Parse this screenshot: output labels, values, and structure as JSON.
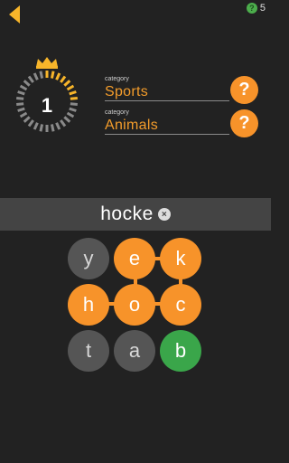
{
  "header": {
    "hint_count": "5",
    "hint_icon": "?"
  },
  "level": {
    "number": "1",
    "dial_filled_fraction": 0.25
  },
  "categories": [
    {
      "label": "category",
      "value": "Sports",
      "help_icon": "?"
    },
    {
      "label": "category",
      "value": "Animals",
      "help_icon": "?"
    }
  ],
  "word": {
    "current": "hocke",
    "clear_icon": "×"
  },
  "grid": {
    "rows": [
      [
        {
          "letter": "y",
          "state": "grey"
        },
        {
          "letter": "e",
          "state": "orange"
        },
        {
          "letter": "k",
          "state": "orange"
        }
      ],
      [
        {
          "letter": "h",
          "state": "orange"
        },
        {
          "letter": "o",
          "state": "orange"
        },
        {
          "letter": "c",
          "state": "orange"
        }
      ],
      [
        {
          "letter": "t",
          "state": "grey"
        },
        {
          "letter": "a",
          "state": "grey"
        },
        {
          "letter": "b",
          "state": "green"
        }
      ]
    ]
  },
  "colors": {
    "accent": "#f7932a",
    "tile_grey": "#555555",
    "tile_green": "#3aa64a",
    "bg": "#222222",
    "word_bar": "#444444"
  }
}
